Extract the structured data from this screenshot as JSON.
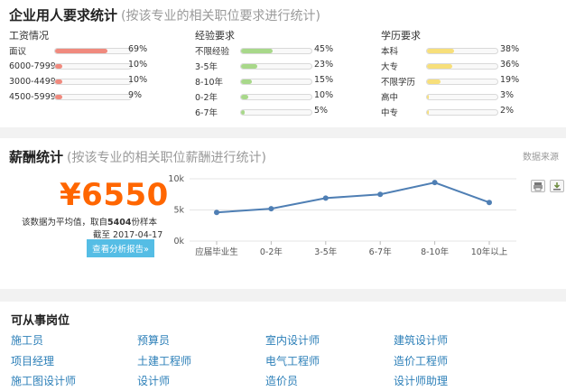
{
  "requirements": {
    "title": "企业用人要求统计",
    "subtitle": "(按该专业的相关职位要求进行统计)",
    "salary_col": {
      "heading": "工资情况",
      "color": "#f08a7e",
      "rows": [
        {
          "label": "面议",
          "value": 69,
          "pct": "69%"
        },
        {
          "label": "6000-7999",
          "value": 10,
          "pct": "10%"
        },
        {
          "label": "3000-4499",
          "value": 10,
          "pct": "10%"
        },
        {
          "label": "4500-5999",
          "value": 9,
          "pct": "9%"
        }
      ]
    },
    "experience_col": {
      "heading": "经验要求",
      "color": "#a8d88a",
      "rows": [
        {
          "label": "不限经验",
          "value": 45,
          "pct": "45%"
        },
        {
          "label": "3-5年",
          "value": 23,
          "pct": "23%"
        },
        {
          "label": "8-10年",
          "value": 15,
          "pct": "15%"
        },
        {
          "label": "0-2年",
          "value": 10,
          "pct": "10%"
        },
        {
          "label": "6-7年",
          "value": 5,
          "pct": "5%"
        }
      ]
    },
    "education_col": {
      "heading": "学历要求",
      "color": "#f7df7a",
      "rows": [
        {
          "label": "本科",
          "value": 38,
          "pct": "38%"
        },
        {
          "label": "大专",
          "value": 36,
          "pct": "36%"
        },
        {
          "label": "不限学历",
          "value": 19,
          "pct": "19%"
        },
        {
          "label": "高中",
          "value": 3,
          "pct": "3%"
        },
        {
          "label": "中专",
          "value": 2,
          "pct": "2%"
        }
      ]
    }
  },
  "salary": {
    "title": "薪酬统计",
    "subtitle": "(按该专业的相关职位薪酬进行统计)",
    "source_label": "数据来源",
    "amount": "¥6550",
    "note_prefix": "该数据为平均值，取自",
    "sample_count": "5404",
    "note_suffix": "份样本",
    "date_prefix": "截至",
    "date": "2017-04-17",
    "report_button": "查看分析报告»",
    "print_icon": "printer-icon",
    "download_icon": "download-icon"
  },
  "chart_data": {
    "type": "line",
    "categories": [
      "应届毕业生",
      "0-2年",
      "3-5年",
      "6-7年",
      "8-10年",
      "10年以上"
    ],
    "series": [
      {
        "values": [
          4600,
          5200,
          6900,
          7500,
          9400,
          6200
        ]
      }
    ],
    "yticks": [
      "10k",
      "5k",
      "0k"
    ],
    "ylim": [
      0,
      10000
    ],
    "line_color": "#4f7fb4",
    "grid": true
  },
  "jobs": {
    "title": "可从事岗位",
    "items": [
      "施工员",
      "预算员",
      "室内设计师",
      "建筑设计师",
      "项目经理",
      "土建工程师",
      "电气工程师",
      "造价工程师",
      "施工图设计师",
      "设计师",
      "造价员",
      "设计师助理"
    ]
  }
}
